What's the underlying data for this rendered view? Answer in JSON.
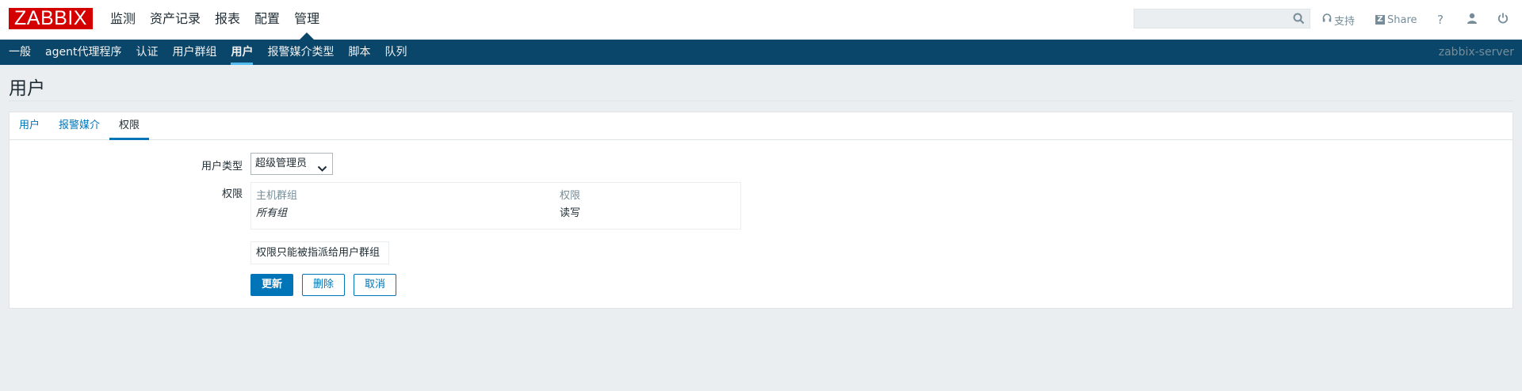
{
  "header": {
    "logo": "ZABBIX",
    "nav": [
      "监测",
      "资产记录",
      "报表",
      "配置",
      "管理"
    ],
    "active_nav": "管理",
    "search": {
      "placeholder": "",
      "value": ""
    },
    "support_label": "支持",
    "share_label": "Share",
    "help_label": "?"
  },
  "subnav": {
    "items": [
      "一般",
      "agent代理程序",
      "认证",
      "用户群组",
      "用户",
      "报警媒介类型",
      "脚本",
      "队列"
    ],
    "active": "用户",
    "server": "zabbix-server"
  },
  "page": {
    "title": "用户"
  },
  "tabs": [
    "用户",
    "报警媒介",
    "权限"
  ],
  "active_tab": "权限",
  "form": {
    "user_type_label": "用户类型",
    "user_type_value": "超级管理员",
    "permissions_label": "权限",
    "table": {
      "headers": [
        "主机群组",
        "权限"
      ],
      "rows": [
        [
          "所有组",
          "读写"
        ]
      ]
    },
    "info": "权限只能被指派给用户群组",
    "buttons": {
      "update": "更新",
      "delete": "删除",
      "cancel": "取消"
    }
  },
  "colors": {
    "brand": "#d40000",
    "subnav_bg": "#0a466a",
    "accent": "#0275b8",
    "background": "#ebeef0"
  }
}
